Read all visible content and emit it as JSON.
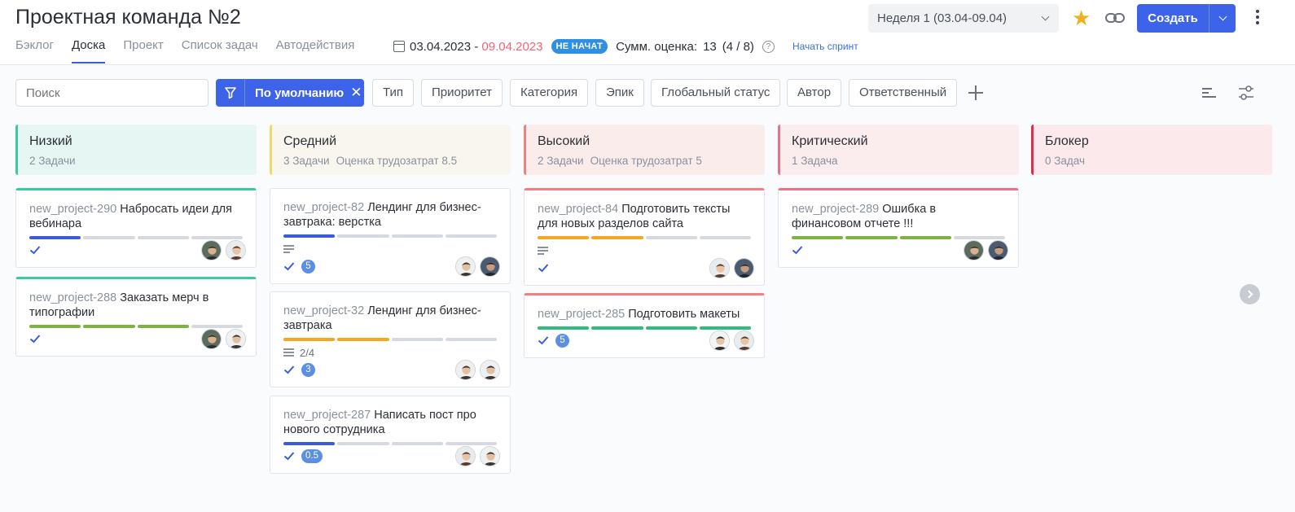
{
  "header": {
    "title": "Проектная команда №2",
    "tabs": [
      {
        "label": "Бэклог",
        "active": false
      },
      {
        "label": "Доска",
        "active": true
      },
      {
        "label": "Проект",
        "active": false
      },
      {
        "label": "Список задач",
        "active": false
      },
      {
        "label": "Автодействия",
        "active": false
      }
    ],
    "week_select": "Неделя 1 (03.04-09.04)",
    "create_label": "Создать"
  },
  "sprint": {
    "date_start": "03.04.2023",
    "date_sep": " - ",
    "date_end": "09.04.2023",
    "status": "НЕ НАЧАТ",
    "estimate_label": "Сумм. оценка:",
    "estimate_value": "13",
    "estimate_breakdown": "(4 / 8)",
    "start_label": "Начать спринт"
  },
  "filters": {
    "search_placeholder": "Поиск",
    "default_filter": "По умолчанию",
    "chips": [
      "Тип",
      "Приоритет",
      "Категория",
      "Эпик",
      "Глобальный статус",
      "Автор",
      "Ответственный"
    ]
  },
  "colors": {
    "accent": "#3c63e8",
    "low": "#3cc9a0",
    "medium": "#f2d56b",
    "high": "#f07f7f",
    "critical": "#ee6f86",
    "blocker": "#d8304e",
    "bar_blue": "#3b5bdb",
    "bar_green": "#7cb342",
    "bar_orange": "#f5a623",
    "bar_teal": "#2ebd7a"
  },
  "columns": [
    {
      "title": "Низкий",
      "count": "2 Задачи",
      "estimate": "",
      "cards": [
        {
          "key": "new_project-290",
          "title": "Набросать идеи для вебинара",
          "progress": 1,
          "bar": "blue",
          "desc": false,
          "checklist": "",
          "badge": "",
          "avatars": [
            "man-cap",
            "woman"
          ]
        },
        {
          "key": "new_project-288",
          "title": "Заказать мерч в типографии",
          "progress": 3,
          "bar": "green",
          "desc": false,
          "checklist": "",
          "badge": "",
          "avatars": [
            "man-cap",
            "man-glasses"
          ]
        }
      ]
    },
    {
      "title": "Средний",
      "count": "3 Задачи",
      "estimate": "Оценка трудозатрат 8.5",
      "cards": [
        {
          "key": "new_project-82",
          "title": "Лендинг для бизнес-завтрака: верстка",
          "progress": 1,
          "bar": "blue",
          "desc": true,
          "checklist": "",
          "badge": "5",
          "avatars": [
            "man-glasses",
            "man-dark"
          ]
        },
        {
          "key": "new_project-32",
          "title": "Лендинг для бизнес-завтрака",
          "progress": 2,
          "bar": "orange",
          "desc": false,
          "checklist": "2/4",
          "badge": "3",
          "avatars": [
            "man-glasses",
            "man-glasses"
          ]
        },
        {
          "key": "new_project-287",
          "title": "Написать пост про нового сотрудника",
          "progress": 1,
          "bar": "blue",
          "desc": false,
          "checklist": "",
          "badge": "0.5",
          "avatars": [
            "woman",
            "man-glasses"
          ]
        }
      ]
    },
    {
      "title": "Высокий",
      "count": "2 Задачи",
      "estimate": "Оценка трудозатрат 5",
      "cards": [
        {
          "key": "new_project-84",
          "title": "Подготовить тексты для новых разделов сайта",
          "progress": 2,
          "bar": "orange",
          "desc": true,
          "checklist": "",
          "badge": "",
          "avatars": [
            "woman",
            "man-dark"
          ]
        },
        {
          "key": "new_project-285",
          "title": "Подготовить макеты",
          "progress": 4,
          "bar": "teal",
          "desc": false,
          "checklist": "",
          "badge": "5",
          "avatars": [
            "man-light",
            "woman"
          ]
        }
      ]
    },
    {
      "title": "Критический",
      "count": "1 Задача",
      "estimate": "",
      "cards": [
        {
          "key": "new_project-289",
          "title": "Ошибка в финансовом отчете !!!",
          "progress": 3,
          "bar": "green",
          "desc": false,
          "checklist": "",
          "badge": "",
          "avatars": [
            "man-cap",
            "man-dark"
          ]
        }
      ]
    },
    {
      "title": "Блокер",
      "count": "0 Задач",
      "estimate": "",
      "cards": []
    }
  ],
  "icons": {
    "star": "star-icon",
    "link": "link-icon",
    "kebab": "more-vertical-icon",
    "filter": "filter-icon",
    "plus": "plus-icon",
    "sort": "sort-icon",
    "settings": "sliders-icon",
    "calendar": "calendar-icon",
    "help": "help-icon",
    "check": "check-icon",
    "scroll": "chevron-right-icon"
  }
}
